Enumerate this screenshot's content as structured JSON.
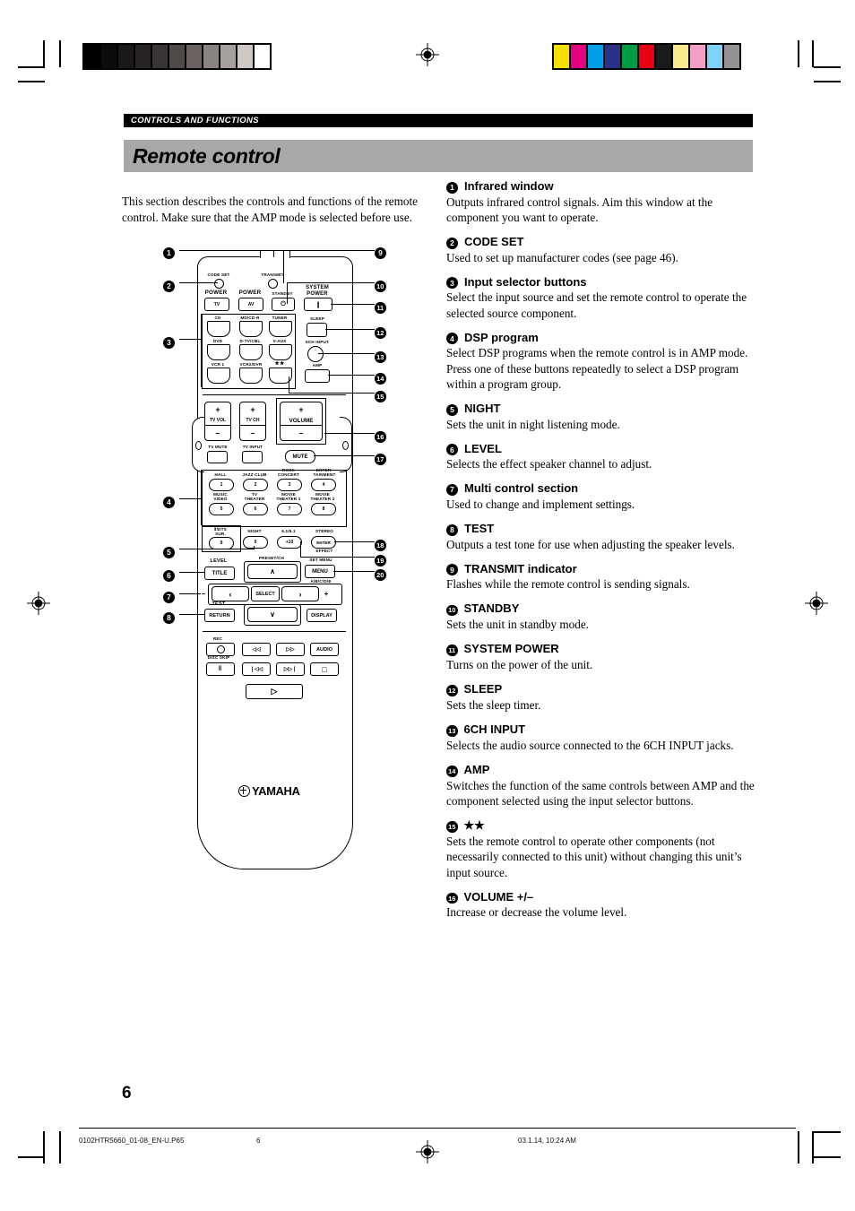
{
  "page": {
    "chapter": "CONTROLS AND FUNCTIONS",
    "title": "Remote control",
    "intro": "This section describes the controls and functions of the remote control. Make sure that the AMP mode is selected before use.",
    "page_number": "6"
  },
  "footer": {
    "file": "0102HTR5660_01-08_EN-U.P65",
    "page": "6",
    "timestamp": "03.1.14, 10:24 AM"
  },
  "entries": [
    {
      "num": "1",
      "title": "Infrared window",
      "body": "Outputs infrared control signals. Aim this window at the component you want to operate."
    },
    {
      "num": "2",
      "title": "CODE SET",
      "body": "Used to set up manufacturer codes (see page 46)."
    },
    {
      "num": "3",
      "title": "Input selector buttons",
      "body": "Select the input source and set the remote control to operate the selected source component."
    },
    {
      "num": "4",
      "title": "DSP program",
      "body": "Select DSP programs when the remote control is in AMP mode. Press one of these buttons repeatedly to select a DSP program within a program group."
    },
    {
      "num": "5",
      "title": "NIGHT",
      "body": "Sets the unit in night listening mode."
    },
    {
      "num": "6",
      "title": "LEVEL",
      "body": "Selects the effect speaker channel to adjust."
    },
    {
      "num": "7",
      "title": "Multi control section",
      "body": "Used to change and implement settings."
    },
    {
      "num": "8",
      "title": "TEST",
      "body": "Outputs a test tone for use when adjusting the speaker levels."
    },
    {
      "num": "9",
      "title": "TRANSMIT indicator",
      "body": "Flashes while the remote control is sending signals."
    },
    {
      "num": "10",
      "title": "STANDBY",
      "body": "Sets the unit in standby mode."
    },
    {
      "num": "11",
      "title": "SYSTEM POWER",
      "body": "Turns on the power of the unit."
    },
    {
      "num": "12",
      "title": "SLEEP",
      "body": "Sets the sleep timer."
    },
    {
      "num": "13",
      "title": "6CH INPUT",
      "body": "Selects the audio source connected to the 6CH INPUT jacks."
    },
    {
      "num": "14",
      "title": "AMP",
      "body": "Switches the function of the same controls between AMP and the component selected using the input selector buttons."
    },
    {
      "num": "15",
      "title": "★★",
      "body": "Sets the remote control to operate other components (not necessarily connected to this unit) without changing this unit’s input source."
    },
    {
      "num": "16",
      "title": "VOLUME +/–",
      "body": "Increase or decrease the volume level."
    }
  ],
  "remote": {
    "indicators": {
      "code_set": "CODE SET",
      "transmit": "TRANSMIT"
    },
    "power_row": [
      {
        "label": "POWER",
        "btn": "TV"
      },
      {
        "label": "POWER",
        "btn": "AV"
      },
      {
        "label": "STANDBY",
        "btn": "⏻"
      },
      {
        "label": "SYSTEM\nPOWER",
        "btn": "❙"
      }
    ],
    "input_selectors": [
      "CD",
      "MD/CD-R",
      "TUNER",
      "DVD",
      "D-TV/CBL",
      "V-AUX",
      "VCR 1",
      "VCR2/DVR",
      "★★"
    ],
    "right_column": [
      {
        "label": "SLEEP",
        "shape": "rect"
      },
      {
        "label": "6CH INPUT",
        "shape": "circle"
      },
      {
        "label": "AMP",
        "shape": "rect"
      }
    ],
    "rockers": [
      {
        "label": "TV VOL",
        "plus": "+",
        "minus": "–"
      },
      {
        "label": "TV CH",
        "plus": "+",
        "minus": "–"
      },
      {
        "label": "VOLUME",
        "plus": "+",
        "minus": "–"
      }
    ],
    "small_row": [
      "TV MUTE",
      "TV INPUT",
      "MUTE"
    ],
    "dsp_buttons": [
      {
        "label": "HALL",
        "num": "1"
      },
      {
        "label": "JAZZ CLUB",
        "num": "2"
      },
      {
        "label": "ROCK\nCONCERT",
        "num": "3"
      },
      {
        "label": "ENTER-\nTAINMENT",
        "num": "4"
      },
      {
        "label": "MUSIC\nVIDEO",
        "num": "5"
      },
      {
        "label": "TV\nTHEATER",
        "num": "6"
      },
      {
        "label": "MOVIE\nTHEATER 1",
        "num": "7"
      },
      {
        "label": "MOVIE\nTHEATER 2",
        "num": "8"
      }
    ],
    "dsp_row3": [
      {
        "label": "Ⅱ/DTS\nSUR.",
        "num": "9"
      },
      {
        "label": "NIGHT",
        "num": "0"
      },
      {
        "label": "6.1/5.1",
        "num": "+10"
      },
      {
        "label": "STEREO",
        "num": "ENTER",
        "sub": "EFFECT"
      }
    ],
    "multi": {
      "level": "LEVEL",
      "title_btn": "TITLE",
      "test": "TEST",
      "return_btn": "RETURN",
      "preset_ch": "PRESET/CH",
      "set_menu": "SET MENU",
      "menu_btn": "MENU",
      "abcde": "A/B/C/D/E",
      "select": "SELECT",
      "display": "DISPLAY",
      "minus": "–",
      "plus": "+",
      "up": "∧",
      "down": "∨",
      "left": "‹",
      "right": "›"
    },
    "transport": {
      "rec": "REC",
      "disc_skip": "DISC SKIP",
      "audio": "AUDIO",
      "rew": "◁◁",
      "ff": "▷▷",
      "prev": "❘◁◁",
      "next": "▷▷❘",
      "pause": "‖",
      "stop": "□",
      "play": "▷"
    },
    "brand": "YAMAHA",
    "callout_numbers": [
      "1",
      "2",
      "3",
      "4",
      "5",
      "6",
      "7",
      "8",
      "9",
      "10",
      "11",
      "12",
      "13",
      "14",
      "15",
      "16",
      "17",
      "18",
      "19",
      "20"
    ]
  },
  "colors": {
    "title_bar_bg": "#a8a8a8",
    "chapter_bar_bg": "#000000",
    "grayscale_ramp": [
      "#000000",
      "#0d0b0b",
      "#1b1818",
      "#282424",
      "#3a3535",
      "#504a48",
      "#6b6361",
      "#8b8380",
      "#a8a09c",
      "#cfc8c4",
      "#ffffff"
    ],
    "color_swatches": [
      "#f5e000",
      "#e4007f",
      "#00a0e9",
      "#2b3189",
      "#009944",
      "#e60012",
      "#1a1a1a",
      "#faeb8e",
      "#f2a0c8",
      "#7ed3f7",
      "#939393"
    ]
  }
}
